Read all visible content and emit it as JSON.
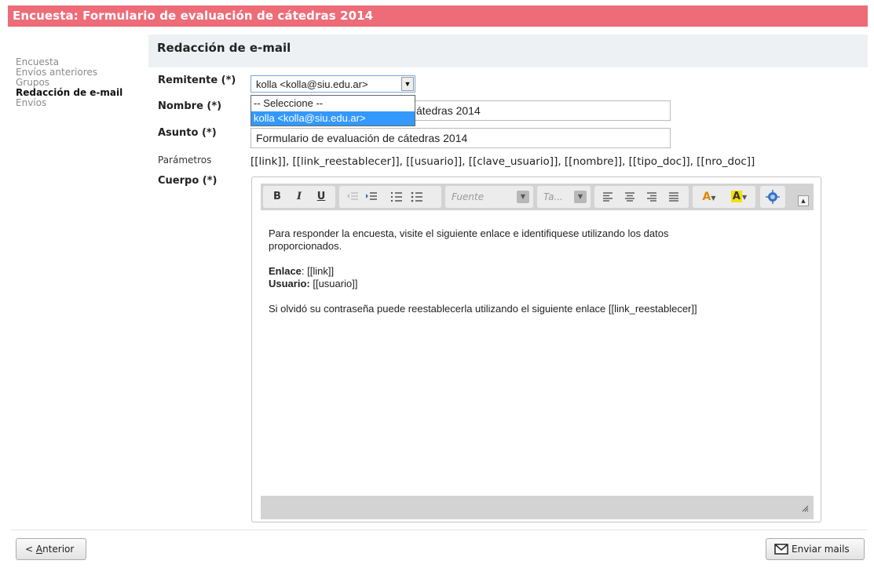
{
  "window": {
    "title": "Encuesta: Formulario de evaluación de cátedras 2014"
  },
  "sidebar": {
    "items": [
      {
        "label": "Encuesta",
        "active": false
      },
      {
        "label": "Envíos anteriores",
        "active": false
      },
      {
        "label": "Grupos",
        "active": false
      },
      {
        "label": "Redacción de e-mail",
        "active": true
      },
      {
        "label": "Envíos",
        "active": false
      }
    ]
  },
  "section": {
    "title": "Redacción de e-mail"
  },
  "form": {
    "remitente": {
      "label": "Remitente (*)",
      "value": "kolla <kolla@siu.edu.ar>",
      "options": [
        "-- Seleccione --",
        "kolla <kolla@siu.edu.ar>"
      ],
      "selected_option": "kolla <kolla@siu.edu.ar>"
    },
    "nombre": {
      "label": "Nombre (*)",
      "visible_value": "átedras 2014"
    },
    "asunto": {
      "label": "Asunto (*)",
      "value": "Formulario de evaluación de cátedras 2014"
    },
    "parametros": {
      "label": "Parámetros",
      "value": "[[link]], [[link_reestablecer]], [[usuario]], [[clave_usuario]], [[nombre]], [[tipo_doc]], [[nro_doc]]"
    },
    "cuerpo": {
      "label": "Cuerpo (*)"
    }
  },
  "editor": {
    "toolbar": {
      "bold": "B",
      "italic": "I",
      "underline": "U",
      "font_placeholder": "Fuente",
      "size_placeholder": "Ta..."
    },
    "content": {
      "line1": "Para responder la encuesta, visite el siguiente enlace e identifiquese utilizando los datos",
      "line2": "proporcionados.",
      "enlace_label": "Enlace",
      "enlace_value": ": [[link]]",
      "usuario_label": "Usuario:",
      "usuario_value": " [[usuario]]",
      "line_reset": "Si olvidó su contraseña puede reestablecerla utilizando el siguiente enlace [[link_reestablecer]]"
    }
  },
  "footer": {
    "prev_prefix": "< ",
    "prev_accel": "A",
    "prev_rest": "nterior",
    "send_label": "Enviar mails"
  },
  "colors": {
    "title_bar": "#ed6c78",
    "section_header": "#eef1f3",
    "selection": "#3399ff"
  }
}
